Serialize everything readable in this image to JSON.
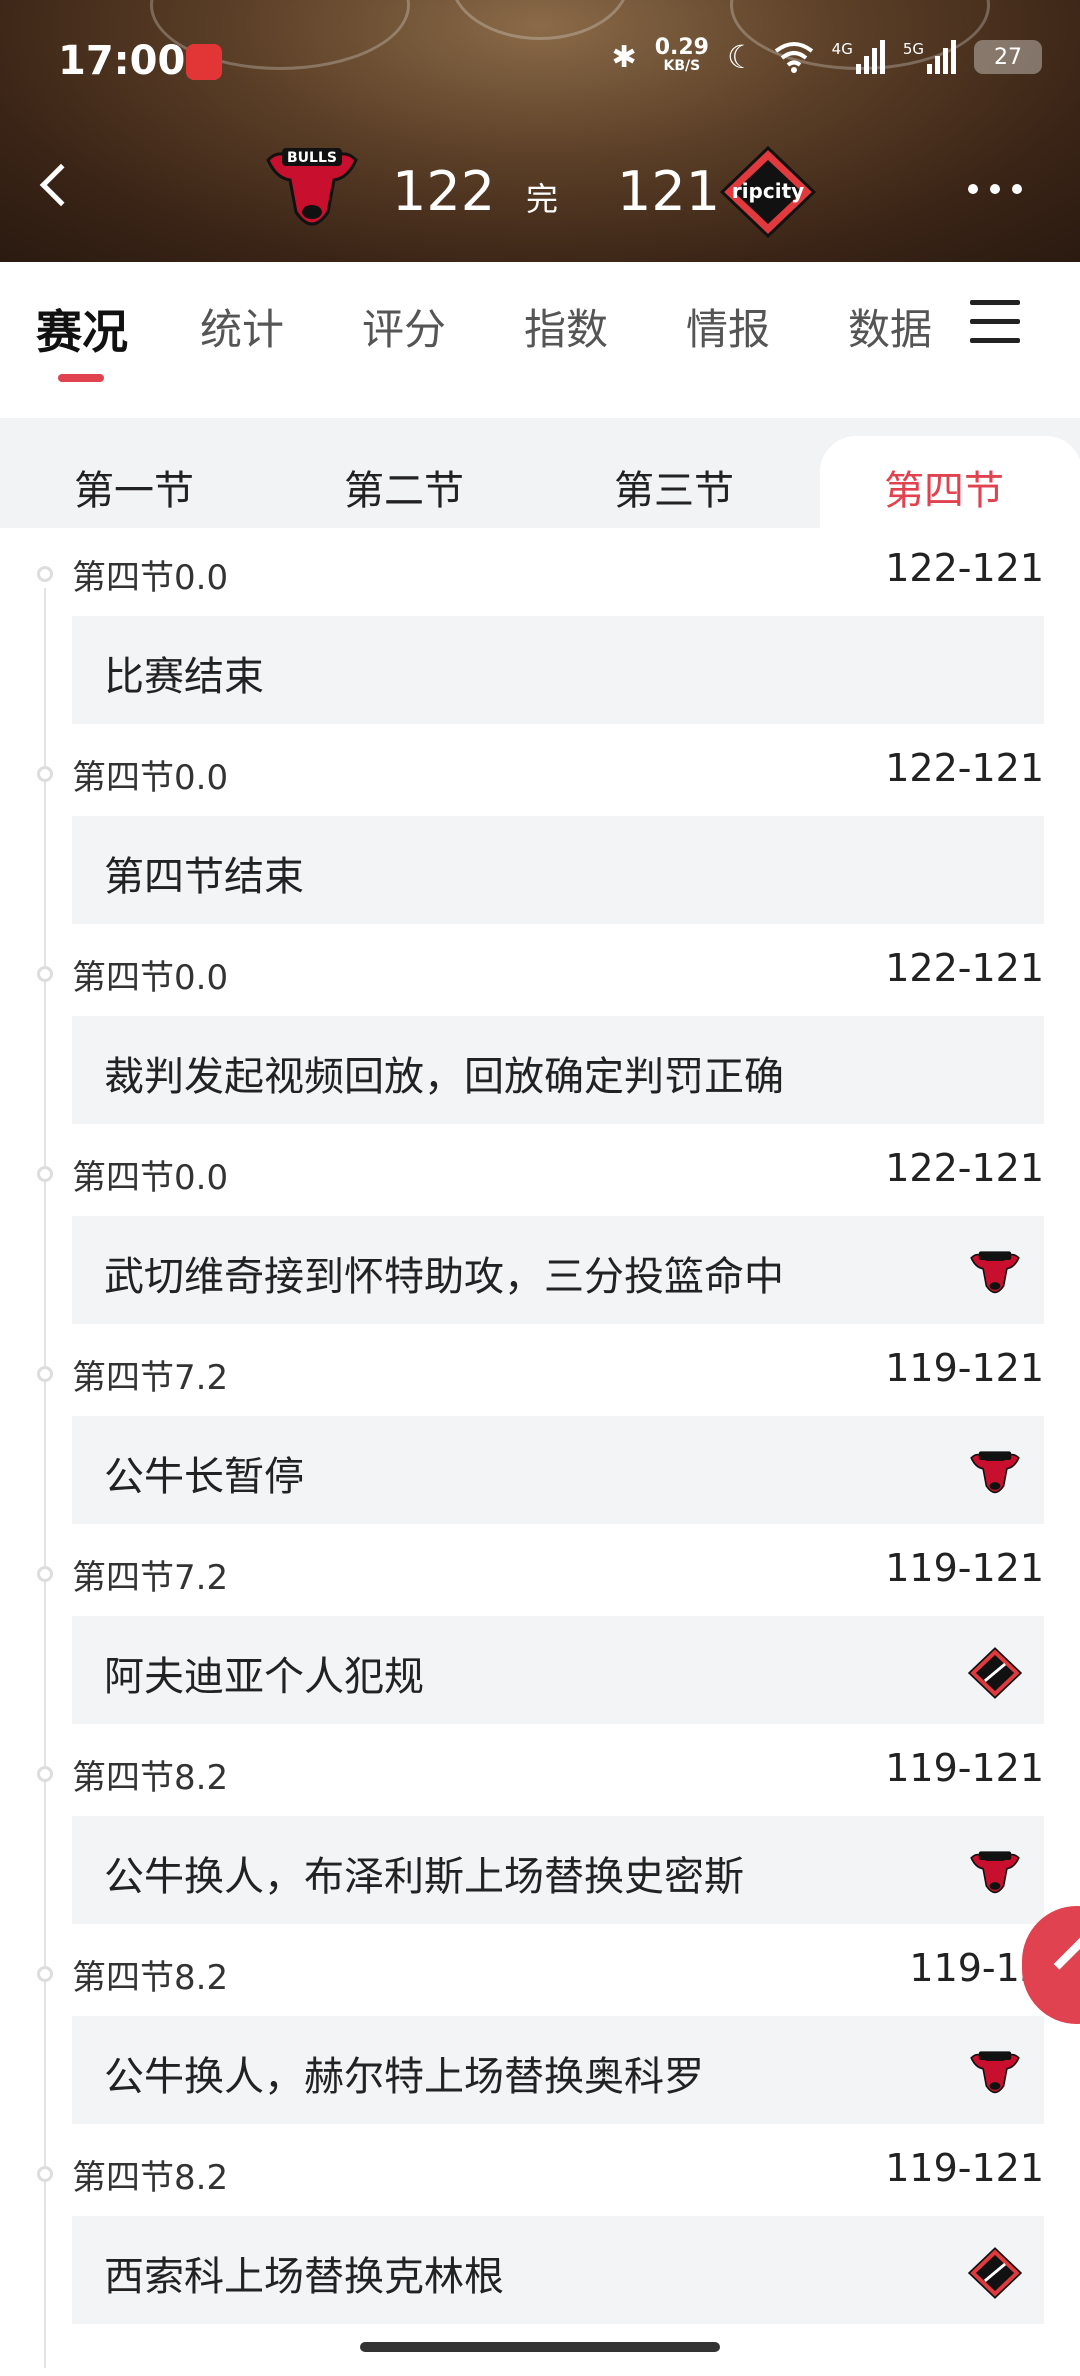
{
  "status_bar": {
    "time": "17:00",
    "net_speed_value": "0.29",
    "net_speed_unit": "KB/S",
    "sig1_label": "4G",
    "sig2_label": "5G",
    "battery": "27"
  },
  "match": {
    "home_score": "122",
    "status": "完",
    "away_score": "121",
    "home_team_logo_text": "BULLS",
    "away_team_logo_text": "ripcity"
  },
  "tabs": [
    "赛况",
    "统计",
    "评分",
    "指数",
    "情报",
    "数据"
  ],
  "active_tab": 0,
  "quarters": [
    "第一节",
    "第二节",
    "第三节",
    "第四节"
  ],
  "active_quarter": 3,
  "events": [
    {
      "time": "第四节0.0",
      "score": "122-121",
      "text": "比赛结束",
      "team": ""
    },
    {
      "time": "第四节0.0",
      "score": "122-121",
      "text": "第四节结束",
      "team": ""
    },
    {
      "time": "第四节0.0",
      "score": "122-121",
      "text": "裁判发起视频回放，回放确定判罚正确",
      "team": ""
    },
    {
      "time": "第四节0.0",
      "score": "122-121",
      "text": "武切维奇接到怀特助攻，三分投篮命中",
      "team": "bulls"
    },
    {
      "time": "第四节7.2",
      "score": "119-121",
      "text": "公牛长暂停",
      "team": "bulls"
    },
    {
      "time": "第四节7.2",
      "score": "119-121",
      "text": "阿夫迪亚个人犯规",
      "team": "blazers"
    },
    {
      "time": "第四节8.2",
      "score": "119-121",
      "text": "公牛换人，布泽利斯上场替换史密斯",
      "team": "bulls"
    },
    {
      "time": "第四节8.2",
      "score": "119-12",
      "text": "公牛换人，赫尔特上场替换奥科罗",
      "team": "bulls"
    },
    {
      "time": "第四节8.2",
      "score": "119-121",
      "text": "西索科上场替换克林根",
      "team": "blazers"
    }
  ],
  "colors": {
    "accent": "#e0434f",
    "bulls_red": "#c8102e",
    "blazers_red": "#e03a3e"
  }
}
